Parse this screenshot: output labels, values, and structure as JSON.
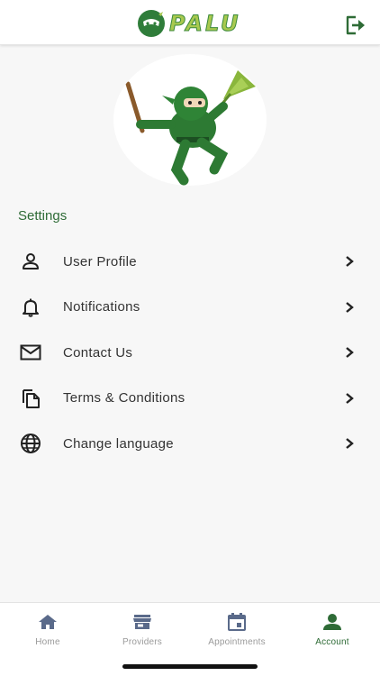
{
  "header": {
    "logo_text": "PALU",
    "logout_icon": "logout-icon"
  },
  "settings": {
    "title": "Settings",
    "items": [
      {
        "label": "User Profile",
        "icon": "user-icon"
      },
      {
        "label": "Notifications",
        "icon": "bell-icon"
      },
      {
        "label": "Contact Us",
        "icon": "envelope-icon"
      },
      {
        "label": "Terms & Conditions",
        "icon": "documents-icon"
      },
      {
        "label": "Change language",
        "icon": "globe-icon"
      }
    ]
  },
  "nav": {
    "items": [
      {
        "label": "Home",
        "icon": "home-icon"
      },
      {
        "label": "Providers",
        "icon": "store-icon"
      },
      {
        "label": "Appointments",
        "icon": "calendar-icon"
      },
      {
        "label": "Account",
        "icon": "account-icon"
      }
    ],
    "active": "Account"
  },
  "colors": {
    "brand_green": "#2e6b36",
    "logo_lime": "#a8c94f",
    "nav_inactive": "#9a9a9a",
    "background": "#f7f7f7"
  }
}
